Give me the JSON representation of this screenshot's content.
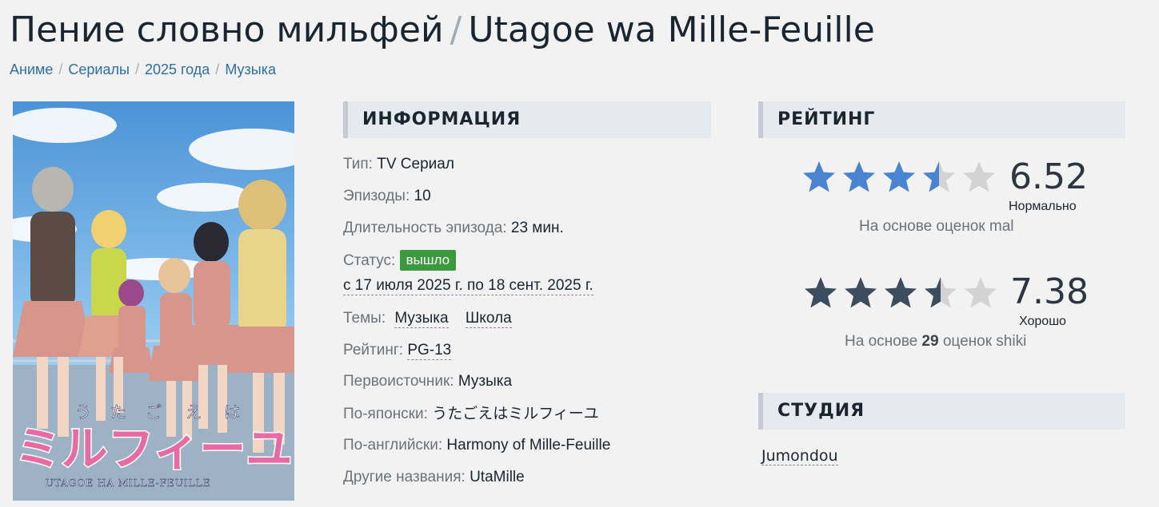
{
  "title": {
    "ru": "Пение словно мильфей",
    "separator": "/",
    "romaji": "Utagoe wa Mille-Feuille"
  },
  "breadcrumbs": [
    "Аниме",
    "Сериалы",
    "2025 года",
    "Музыка"
  ],
  "poster": {
    "kana": [
      "う",
      "た",
      "ご",
      "え",
      "は"
    ],
    "logo_text": "ミルフィーユ",
    "logo_sub": "UTAGOE HA MILLE-FEUILLE"
  },
  "info": {
    "heading": "ИНФОРМАЦИЯ",
    "type": {
      "label": "Тип:",
      "value": "TV Сериал"
    },
    "episodes": {
      "label": "Эпизоды:",
      "value": "10"
    },
    "duration": {
      "label": "Длительность эпизода:",
      "value": "23 мин."
    },
    "status": {
      "label": "Статус:",
      "badge": "вышло",
      "dates": "с 17 июля 2025 г. по 18 сент. 2025 г."
    },
    "themes": {
      "label": "Темы:",
      "items": [
        "Музыка",
        "Школа"
      ]
    },
    "rating": {
      "label": "Рейтинг:",
      "value": "PG-13"
    },
    "source": {
      "label": "Первоисточник:",
      "value": "Музыка"
    },
    "japanese": {
      "label": "По-японски:",
      "value": "うたごえはミルフィーユ"
    },
    "english": {
      "label": "По-английски:",
      "value": "Harmony of Mille-Feuille"
    },
    "other": {
      "label": "Другие названия:",
      "value": "UtaMille"
    }
  },
  "ratings": {
    "heading": "РЕЙТИНГ",
    "mal": {
      "score": "6.52",
      "stars": 3.5,
      "word": "Нормально",
      "note": "На основе оценок mal",
      "star_color": "#4a84d0"
    },
    "shiki": {
      "score": "7.38",
      "stars": 3.5,
      "word": "Хорошо",
      "note_prefix": "На основе",
      "count": "29",
      "note_suffix": "оценок shiki",
      "star_color": "#3d4d60"
    },
    "empty_star_color": "#d3d3d3"
  },
  "studio": {
    "heading": "СТУДИЯ",
    "name": "Jumondou"
  }
}
